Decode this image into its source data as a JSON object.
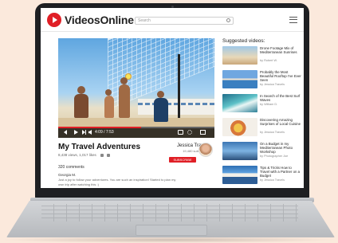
{
  "site": {
    "name": "VideosOnline"
  },
  "search": {
    "placeholder": "Search"
  },
  "video": {
    "time": "4:09 / 7:53",
    "progress": 0.53,
    "title": "My Travel Adventures",
    "stats": "8,438 views, 1,017 likes",
    "channel": "Jessica Travels",
    "subscribers": "19,480 subscribers",
    "subscribe_label": "SUBSCRIBE"
  },
  "comments": {
    "count_label": "320 comments",
    "first": {
      "author": "Georgia M.",
      "text": "Just a joy to follow your adventures. You are such an inspiration! Started to plan my own trip after watching this :)"
    }
  },
  "sidebar": {
    "title": "Suggested videos:",
    "items": [
      {
        "title": "Drone Footage Mix of Mediterranean Sunrises",
        "by": "by Robert W."
      },
      {
        "title": "Probably the Most Beautiful Rooftop I've Ever Seen",
        "by": "by Jessica Travels"
      },
      {
        "title": "In Search of the Best Surf Waves",
        "by": "by William D."
      },
      {
        "title": "Discovering Amazing Surprises of Local Cuisine",
        "by": "by Jessica Travels"
      },
      {
        "title": "On a Budget in my Mediterranean Photo Workshop",
        "by": "by Photographer Joe"
      },
      {
        "title": "Tips & Tricks How to Travel with a Partner on a Budget",
        "by": "by Jessica Travels"
      }
    ]
  },
  "icons": [
    "video-logo-icon",
    "search-icon",
    "menu-icon",
    "play-icon",
    "skip-icon",
    "volume-icon",
    "cc-icon",
    "gear-icon",
    "fullscreen-icon",
    "like-icon",
    "dislike-icon"
  ],
  "colors": {
    "accent": "#e01f26",
    "laptop_bezel": "#1e1f22",
    "background": "#fbe9dc"
  }
}
